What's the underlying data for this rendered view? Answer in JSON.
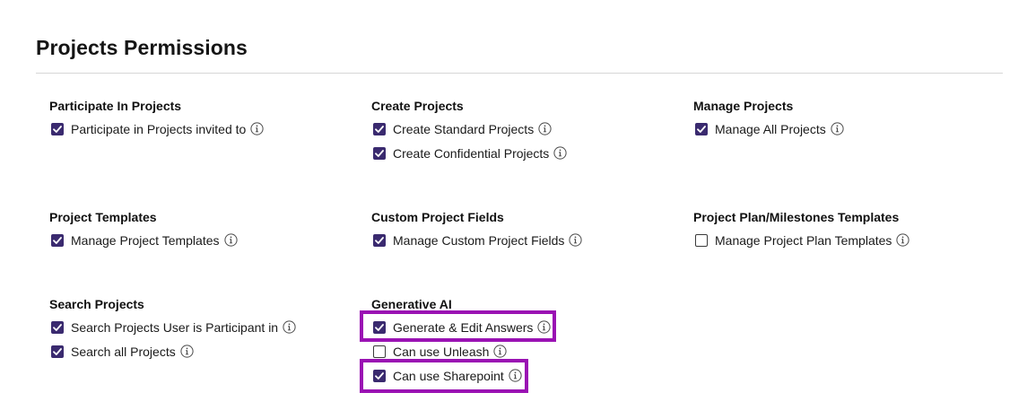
{
  "page": {
    "title": "Projects Permissions"
  },
  "colors": {
    "checkbox_checked": "#3a2a6f",
    "highlight": "#9a12b3",
    "divider": "#d6d6d6"
  },
  "groups": [
    {
      "title": "Participate In Projects",
      "items": [
        {
          "label": "Participate in Projects invited to",
          "checked": true,
          "icon": "info-icon"
        }
      ]
    },
    {
      "title": "Create Projects",
      "items": [
        {
          "label": "Create Standard Projects",
          "checked": true,
          "icon": "info-icon"
        },
        {
          "label": "Create Confidential Projects",
          "checked": true,
          "icon": "info-icon"
        }
      ]
    },
    {
      "title": "Manage Projects",
      "items": [
        {
          "label": "Manage All Projects",
          "checked": true,
          "icon": "info-icon"
        }
      ]
    },
    {
      "title": "Project Templates",
      "items": [
        {
          "label": "Manage Project Templates",
          "checked": true,
          "icon": "info-icon"
        }
      ]
    },
    {
      "title": "Custom Project Fields",
      "items": [
        {
          "label": "Manage Custom Project Fields",
          "checked": true,
          "icon": "info-icon"
        }
      ]
    },
    {
      "title": "Project Plan/Milestones Templates",
      "items": [
        {
          "label": "Manage Project Plan Templates",
          "checked": false,
          "icon": "info-icon"
        }
      ]
    },
    {
      "title": "Search Projects",
      "items": [
        {
          "label": "Search Projects User is Participant in",
          "checked": true,
          "icon": "info-icon"
        },
        {
          "label": "Search all Projects",
          "checked": true,
          "icon": "info-icon"
        }
      ]
    },
    {
      "title": "Generative AI",
      "items": [
        {
          "label": "Generate & Edit Answers",
          "checked": true,
          "icon": "info-icon",
          "highlighted": true
        },
        {
          "label": "Can use Unleash",
          "checked": false,
          "icon": "info-icon"
        },
        {
          "label": "Can use Sharepoint",
          "checked": true,
          "icon": "info-icon",
          "highlighted": true
        }
      ]
    }
  ]
}
